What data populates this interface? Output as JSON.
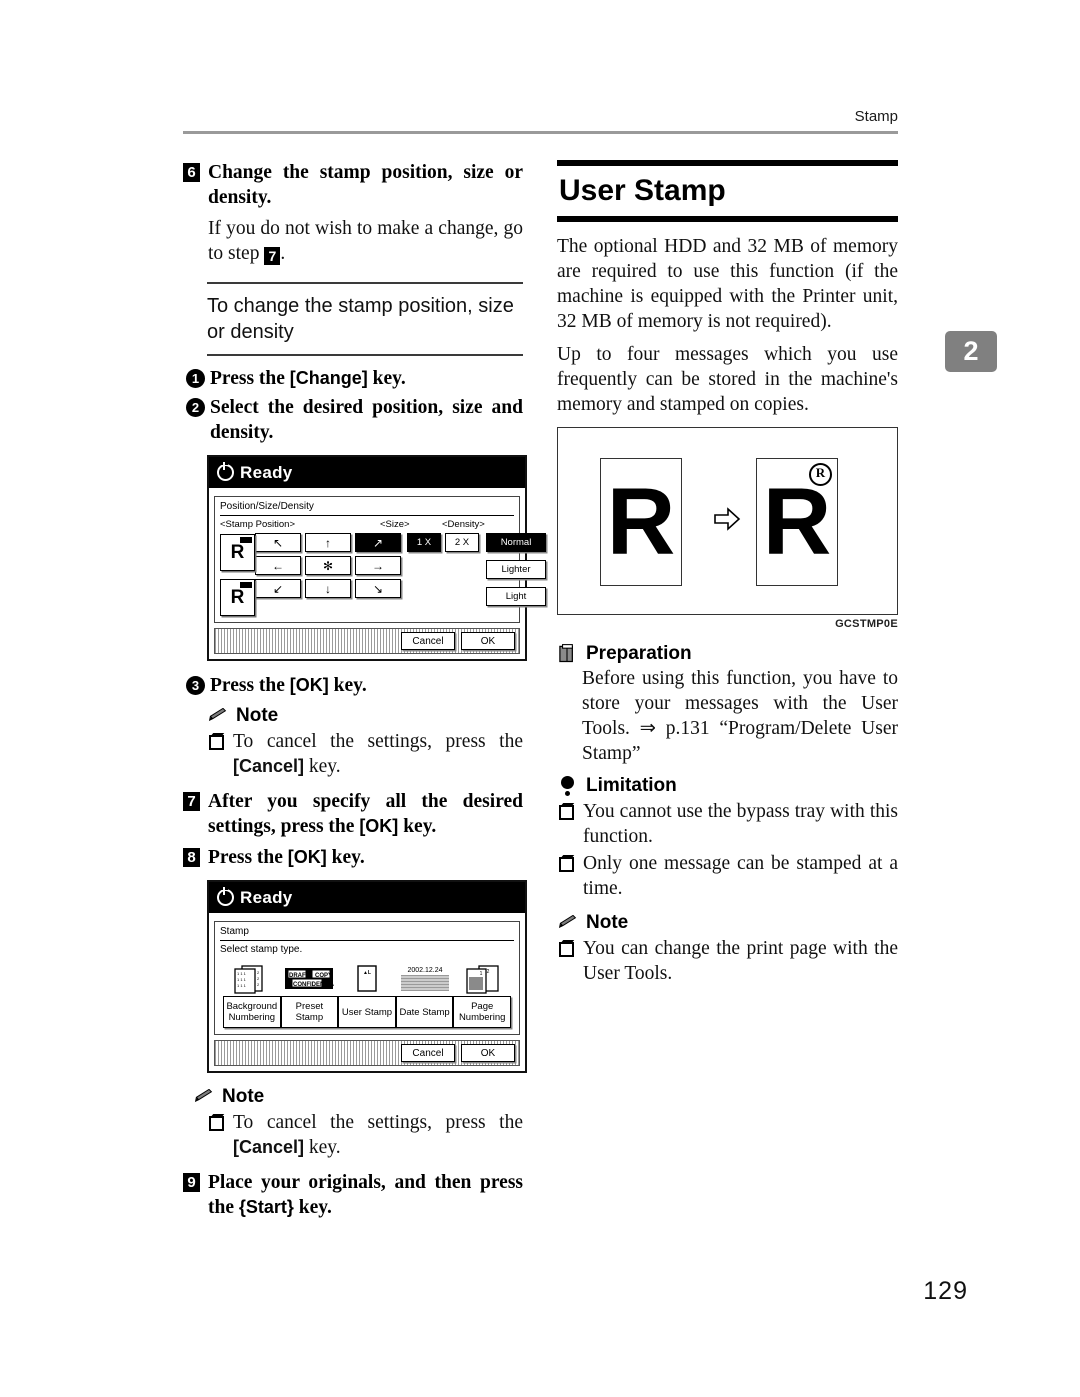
{
  "header": {
    "running_head": "Stamp"
  },
  "chapter_tab": {
    "number": "2",
    "color": "#808080"
  },
  "page_number": "129",
  "left_column": {
    "step6": {
      "num": "6",
      "text": "Change the stamp position, size or density.",
      "body_before": "If you do not wish to make a change, go to step ",
      "body_step_ref": "7",
      "body_after": "."
    },
    "subsection_title": "To change the stamp position, size or density",
    "substeps": [
      {
        "num": "1",
        "pre": "Press the ",
        "key": "[Change]",
        "post": " key."
      },
      {
        "num": "2",
        "pre": "Select the desired position, size and density.",
        "key": "",
        "post": ""
      },
      {
        "num": "3",
        "pre": "Press the ",
        "key": "[OK]",
        "post": " key."
      }
    ],
    "note1": {
      "label": "Note",
      "bullet_pre": "To cancel the settings, press the ",
      "bullet_key": "[Cancel]",
      "bullet_post": " key."
    },
    "step7": {
      "num": "7",
      "pre": "After you specify all the desired settings, press the ",
      "key": "[OK]",
      "post": " key."
    },
    "step8": {
      "num": "8",
      "pre": "Press the ",
      "key": "[OK]",
      "post": " key."
    },
    "note2": {
      "label": "Note",
      "bullet_pre": "To cancel the settings, press the ",
      "bullet_key": "[Cancel]",
      "bullet_post": " key."
    },
    "step9": {
      "num": "9",
      "pre": "Place your originals, and then press the ",
      "key": "{Start}",
      "post": " key."
    }
  },
  "lcd_position": {
    "status": "Ready",
    "screen_title": "Position/Size/Density",
    "group_labels": {
      "position": "<Stamp Position>",
      "size": "<Size>",
      "density": "<Density>"
    },
    "arrows": [
      {
        "glyph": "↖",
        "name": "top-left",
        "selected": false
      },
      {
        "glyph": "↑",
        "name": "top-center",
        "selected": false
      },
      {
        "glyph": "↗",
        "name": "top-right",
        "selected": true
      },
      {
        "glyph": "←",
        "name": "middle-left",
        "selected": false
      },
      {
        "glyph": "✻",
        "name": "center",
        "selected": false
      },
      {
        "glyph": "→",
        "name": "middle-right",
        "selected": false
      },
      {
        "glyph": "↙",
        "name": "bottom-left",
        "selected": false
      },
      {
        "glyph": "↓",
        "name": "bottom-center",
        "selected": false
      },
      {
        "glyph": "↘",
        "name": "bottom-right",
        "selected": false
      }
    ],
    "sizes": [
      {
        "label": "1 X",
        "selected": true
      },
      {
        "label": "2 X",
        "selected": false
      }
    ],
    "densities": [
      {
        "label": "Normal",
        "selected": true
      },
      {
        "label": "Lighter",
        "selected": false
      },
      {
        "label": "Light",
        "selected": false
      }
    ],
    "preview_letter": "R",
    "footer_buttons": [
      {
        "label": "Cancel"
      },
      {
        "label": "OK"
      }
    ]
  },
  "lcd_stamp": {
    "status": "Ready",
    "screen_title": "Stamp",
    "instruction": "Select stamp type.",
    "buttons": [
      {
        "label_line1": "Background",
        "label_line2": "Numbering",
        "icon": "background-numbering-icon"
      },
      {
        "label_line1": "Preset",
        "label_line2": "Stamp",
        "icon": "preset-stamp-icon"
      },
      {
        "label_line1": "User Stamp",
        "label_line2": "",
        "icon": "user-stamp-icon"
      },
      {
        "label_line1": "Date Stamp",
        "label_line2": "",
        "icon": "date-stamp-icon"
      },
      {
        "label_line1": "Page",
        "label_line2": "Numbering",
        "icon": "page-numbering-icon"
      }
    ],
    "preset_icon_words": [
      "DRAFT",
      "COPY",
      "CONFIDENTIAL"
    ],
    "user_stamp_icon_word": "AL",
    "date_icon_text": "2002.12.24",
    "page_icon_numbers": [
      "1",
      "2"
    ],
    "footer_buttons": [
      {
        "label": "Cancel"
      },
      {
        "label": "OK"
      }
    ]
  },
  "right_column": {
    "section_title": "User Stamp",
    "paragraphs": [
      "The optional HDD and 32 MB of memory are required to use this function (if the machine is equipped with the Printer unit, 32 MB of memory is not required).",
      "Up to four messages which you use frequently can be stored in the machine's memory and stamped on copies."
    ],
    "figure": {
      "left_letter": "R",
      "right_letter": "R",
      "reg_mark": "R",
      "caption": "GCSTMP0E"
    },
    "preparation": {
      "label": "Preparation",
      "text": "Before using this function, you have to store your messages with the User Tools. ⇒ p.131 “Program/Delete User Stamp”"
    },
    "limitation": {
      "label": "Limitation",
      "bullets": [
        "You cannot use the bypass tray with this function.",
        "Only one message can be stamped at a time."
      ]
    },
    "note": {
      "label": "Note",
      "bullets": [
        "You can change the print page with the User Tools."
      ]
    }
  }
}
